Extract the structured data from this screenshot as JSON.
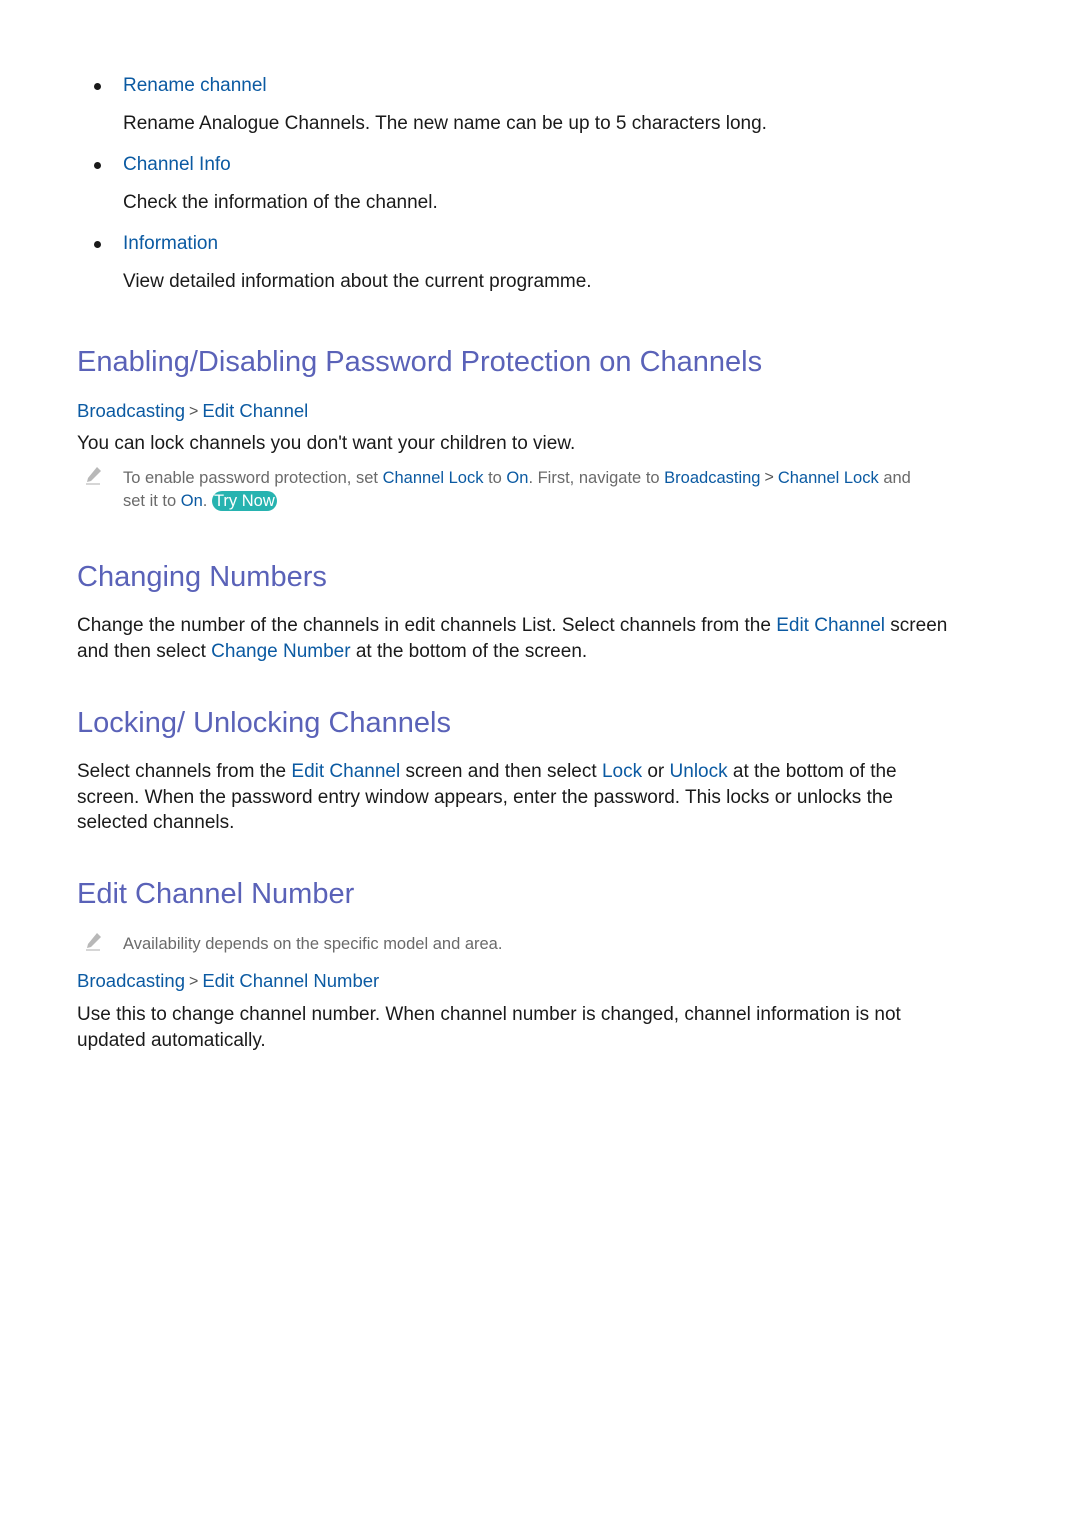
{
  "bullets": [
    {
      "title": "Rename channel",
      "desc": "Rename Analogue Channels. The new name can be up to 5 characters long."
    },
    {
      "title": "Channel Info",
      "desc": "Check the information of the channel."
    },
    {
      "title": "Information",
      "desc": "View detailed information about the current programme."
    }
  ],
  "sections": {
    "password": {
      "heading": "Enabling/Disabling Password Protection on Channels",
      "crumb": [
        "Broadcasting",
        "Edit Channel"
      ],
      "body": "You can lock channels you don't want your children to view.",
      "note": {
        "t1": "To enable password protection, set ",
        "l1": "Channel Lock",
        "t2": " to ",
        "l2": "On",
        "t3": ". First, navigate to ",
        "l3": "Broadcasting",
        "l4": "Channel Lock",
        "t4": " and",
        "t5": "set it to ",
        "l5": "On",
        "t6": ". ",
        "try_now": "Try Now"
      }
    },
    "changing": {
      "heading": "Changing Numbers",
      "p1": "Change the number of the channels in edit channels List. Select channels from the ",
      "l1": "Edit Channel",
      "p2": " screen",
      "p3": "and then select ",
      "l2": "Change Number",
      "p4": " at the bottom of the screen."
    },
    "locking": {
      "heading": "Locking/ Unlocking Channels",
      "p1": "Select channels from the ",
      "l1": "Edit Channel",
      "p2": " screen and then select ",
      "l2": "Lock",
      "p3": " or ",
      "l3": "Unlock",
      "p4": " at the bottom of the",
      "p5": "screen. When the password entry window appears, enter the password. This locks or unlocks the",
      "p6": "selected channels."
    },
    "editnum": {
      "heading": "Edit Channel Number",
      "note": "Availability depends on the specific model and area.",
      "crumb": [
        "Broadcasting",
        "Edit Channel Number"
      ],
      "p1": "Use this to change channel number. When channel number is changed, channel information is not",
      "p2": "updated automatically."
    }
  },
  "icons": {
    "pencil": "pencil-icon",
    "chevron": ">"
  }
}
